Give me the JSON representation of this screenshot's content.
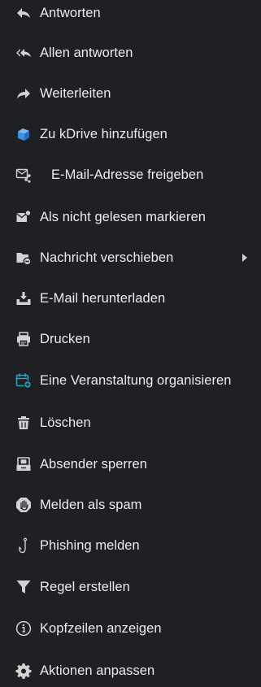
{
  "menu": {
    "items": [
      {
        "label": "Antworten",
        "icon": "reply-icon"
      },
      {
        "label": "Allen antworten",
        "icon": "reply-all-icon"
      },
      {
        "label": "Weiterleiten",
        "icon": "forward-icon"
      },
      {
        "label": "Zu kDrive hinzufügen",
        "icon": "kdrive-icon"
      },
      {
        "label": "E-Mail-Adresse freigeben",
        "icon": "share-email-icon"
      },
      {
        "label": "Als nicht gelesen markieren",
        "icon": "mark-unread-icon"
      },
      {
        "label": "Nachricht verschieben",
        "icon": "move-folder-icon",
        "has_submenu": true
      },
      {
        "label": "E-Mail herunterladen",
        "icon": "download-icon"
      },
      {
        "label": "Drucken",
        "icon": "print-icon"
      },
      {
        "label": "Eine Veranstaltung organisieren",
        "icon": "calendar-add-icon"
      },
      {
        "label": "Löschen",
        "icon": "trash-icon"
      },
      {
        "label": "Absender sperren",
        "icon": "block-sender-icon"
      },
      {
        "label": "Melden als spam",
        "icon": "spam-hand-icon"
      },
      {
        "label": "Phishing melden",
        "icon": "phishing-hook-icon"
      },
      {
        "label": "Regel erstellen",
        "icon": "filter-icon"
      },
      {
        "label": "Kopfzeilen anzeigen",
        "icon": "info-icon"
      },
      {
        "label": "Aktionen anpassen",
        "icon": "gear-icon"
      }
    ]
  },
  "colors": {
    "background": "#1f2023",
    "text": "#ececec",
    "icon": "#d2d2d2",
    "accent_blue": "#3d8fe0",
    "accent_teal": "#1aa8c4"
  }
}
